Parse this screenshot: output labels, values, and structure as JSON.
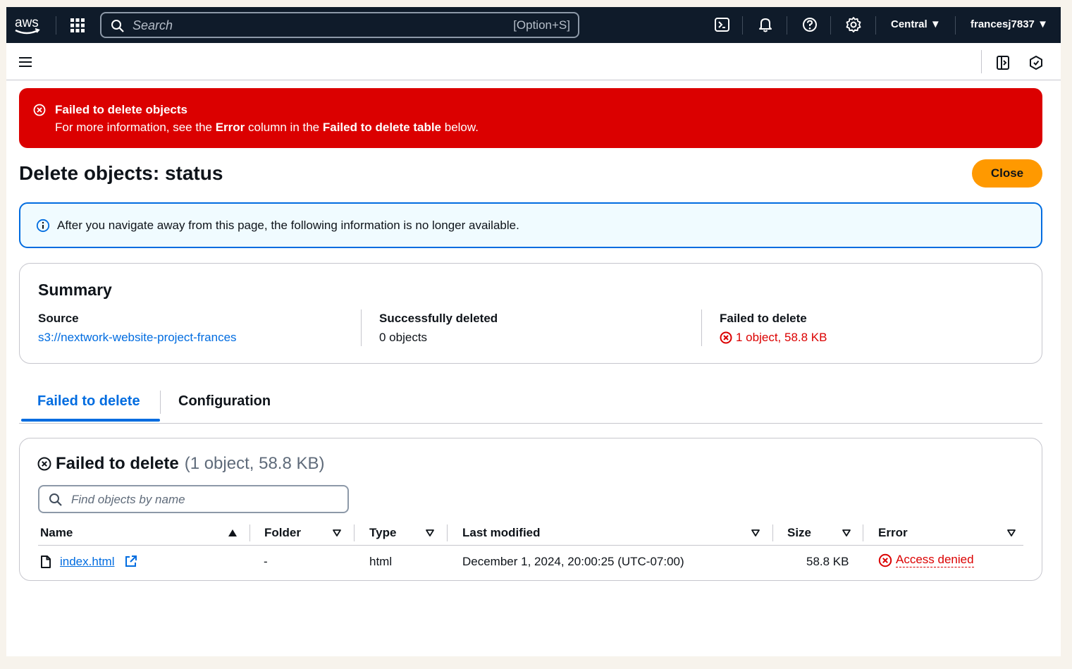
{
  "topnav": {
    "logo_text": "aws",
    "search_placeholder": "Search",
    "search_shortcut": "[Option+S]",
    "region": "Central ▼",
    "user": "francesj7837 ▼",
    "icons": [
      "cloudshell-icon",
      "bell-icon",
      "help-icon",
      "settings-icon"
    ]
  },
  "flash": {
    "title": "Failed to delete objects",
    "message_prefix": "For more information, see the ",
    "message_bold1": "Error",
    "message_mid": " column in the ",
    "message_bold2": "Failed to delete table",
    "message_suffix": " below."
  },
  "page": {
    "title": "Delete objects: status",
    "close_label": "Close"
  },
  "info_alert": {
    "text": "After you navigate away from this page, the following information is no longer available."
  },
  "summary": {
    "title": "Summary",
    "source_label": "Source",
    "source_value": "s3://nextwork-website-project-frances",
    "success_label": "Successfully deleted",
    "success_value": " 0 objects",
    "failed_label": "Failed to delete",
    "failed_value": "1 object, 58.8 KB"
  },
  "tabs": [
    {
      "label": "Failed to delete",
      "active": true
    },
    {
      "label": "Configuration",
      "active": false
    }
  ],
  "failed_table": {
    "title": "Failed to delete",
    "count": "(1 object, 58.8 KB)",
    "filter_placeholder": "Find objects by name",
    "columns": [
      "Name",
      "Folder",
      "Type",
      "Last modified",
      "Size",
      "Error"
    ],
    "rows": [
      {
        "name": "index.html",
        "folder": "-",
        "type": "html",
        "last_modified": "December 1, 2024, 20:00:25 (UTC-07:00)",
        "size": "58.8 KB",
        "error": "Access denied"
      }
    ]
  },
  "colors": {
    "nav_bg": "#0f1b2a",
    "error_red": "#db0000",
    "link_blue": "#006ce0",
    "primary_orange": "#ff9900",
    "info_bg": "#f0fbff"
  }
}
